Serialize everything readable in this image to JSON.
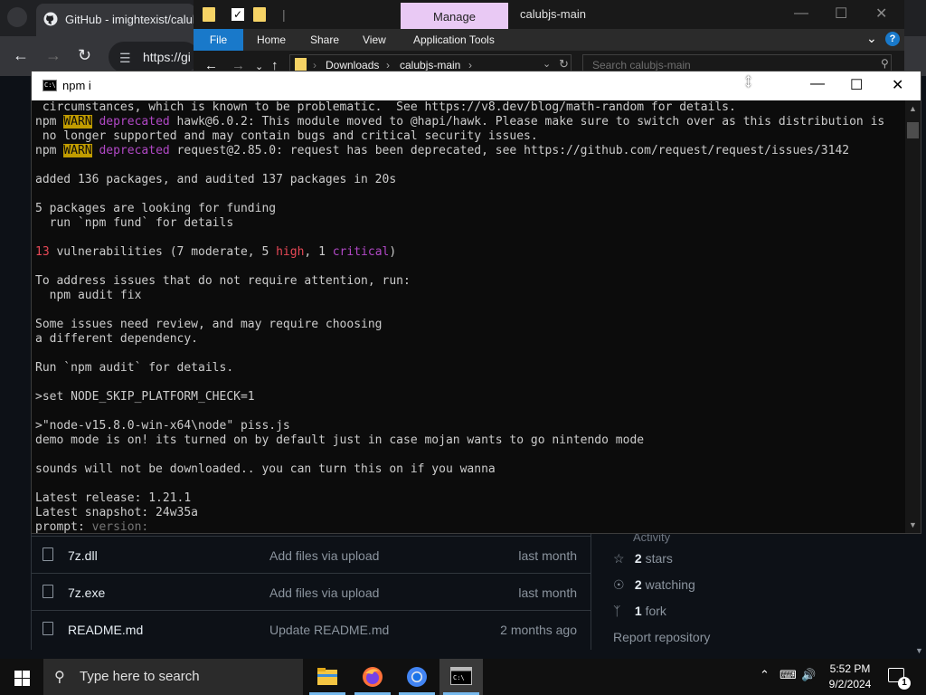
{
  "browser": {
    "tab_title": "GitHub - imightexist/calub",
    "url_partial": "https://gi"
  },
  "explorer": {
    "manage_tab": "Manage",
    "window_title": "calubjs-main",
    "ribbon": {
      "file": "File",
      "home": "Home",
      "share": "Share",
      "view": "View",
      "application_tools": "Application Tools"
    },
    "breadcrumbs": [
      "Downloads",
      "calubjs-main"
    ],
    "search_placeholder": "Search calubjs-main"
  },
  "cmd": {
    "title": "npm i",
    "icon_text": "C:\\",
    "lines": [
      [
        {
          "t": " circumstances, which is known to be problematic.  See https://v8.dev/blog/math-random for details.",
          "c": ""
        }
      ],
      [
        {
          "t": "npm ",
          "c": ""
        },
        {
          "t": "WARN",
          "c": "warn"
        },
        {
          "t": " ",
          "c": ""
        },
        {
          "t": "deprecated",
          "c": "dep"
        },
        {
          "t": " hawk@6.0.2: This module moved to @hapi/hawk. Please make sure to switch over as this distribution is",
          "c": ""
        }
      ],
      [
        {
          "t": " no longer supported and may contain bugs and critical security issues.",
          "c": ""
        }
      ],
      [
        {
          "t": "npm ",
          "c": ""
        },
        {
          "t": "WARN",
          "c": "warn"
        },
        {
          "t": " ",
          "c": ""
        },
        {
          "t": "deprecated",
          "c": "dep"
        },
        {
          "t": " request@2.85.0: request has been deprecated, see https://github.com/request/request/issues/3142",
          "c": ""
        }
      ],
      [
        {
          "t": "",
          "c": ""
        }
      ],
      [
        {
          "t": "added 136 packages, and audited 137 packages in 20s",
          "c": ""
        }
      ],
      [
        {
          "t": "",
          "c": ""
        }
      ],
      [
        {
          "t": "5 packages are looking for funding",
          "c": ""
        }
      ],
      [
        {
          "t": "  run `npm fund` for details",
          "c": ""
        }
      ],
      [
        {
          "t": "",
          "c": ""
        }
      ],
      [
        {
          "t": "13",
          "c": "red"
        },
        {
          "t": " vulnerabilities (7 moderate, 5 ",
          "c": ""
        },
        {
          "t": "high",
          "c": "red"
        },
        {
          "t": ", 1 ",
          "c": ""
        },
        {
          "t": "critical",
          "c": "mag"
        },
        {
          "t": ")",
          "c": ""
        }
      ],
      [
        {
          "t": "",
          "c": ""
        }
      ],
      [
        {
          "t": "To address issues that do not require attention, run:",
          "c": ""
        }
      ],
      [
        {
          "t": "  npm audit fix",
          "c": ""
        }
      ],
      [
        {
          "t": "",
          "c": ""
        }
      ],
      [
        {
          "t": "Some issues need review, and may require choosing",
          "c": ""
        }
      ],
      [
        {
          "t": "a different dependency.",
          "c": ""
        }
      ],
      [
        {
          "t": "",
          "c": ""
        }
      ],
      [
        {
          "t": "Run `npm audit` for details.",
          "c": ""
        }
      ],
      [
        {
          "t": "",
          "c": ""
        }
      ],
      [
        {
          "t": ">set NODE_SKIP_PLATFORM_CHECK=1",
          "c": ""
        }
      ],
      [
        {
          "t": "",
          "c": ""
        }
      ],
      [
        {
          "t": ">\"node-v15.8.0-win-x64\\node\" piss.js",
          "c": ""
        }
      ],
      [
        {
          "t": "demo mode is on! its turned on by default just in case mojan wants to go nintendo mode",
          "c": ""
        }
      ],
      [
        {
          "t": "",
          "c": ""
        }
      ],
      [
        {
          "t": "sounds will not be downloaded.. you can turn this on if you wanna",
          "c": ""
        }
      ],
      [
        {
          "t": "",
          "c": ""
        }
      ],
      [
        {
          "t": "Latest release: 1.21.1",
          "c": ""
        }
      ],
      [
        {
          "t": "Latest snapshot: 24w35a",
          "c": ""
        }
      ],
      [
        {
          "t": "prompt: ",
          "c": ""
        },
        {
          "t": "version:",
          "c": "dim"
        }
      ]
    ]
  },
  "github": {
    "files": [
      {
        "name": "7z.dll",
        "message": "Add files via upload",
        "date": "last month"
      },
      {
        "name": "7z.exe",
        "message": "Add files via upload",
        "date": "last month"
      },
      {
        "name": "README.md",
        "message": "Update README.md",
        "date": "2 months ago"
      }
    ],
    "sidebar": {
      "activity": "Activity",
      "stars_count": "2",
      "stars_label": "stars",
      "watching_count": "2",
      "watching_label": "watching",
      "forks_count": "1",
      "forks_label": "fork",
      "report": "Report repository"
    }
  },
  "taskbar": {
    "search_placeholder": "Type here to search",
    "time": "5:52 PM",
    "date": "9/2/2024",
    "notification_count": "1"
  },
  "colors": {
    "warn_bg": "#c19c00",
    "deprecated": "#b148c6",
    "error_red": "#e74856",
    "cmd_bg": "#0c0c0c",
    "manage_tab": "#e9c9f4",
    "file_tab": "#1979ca"
  }
}
